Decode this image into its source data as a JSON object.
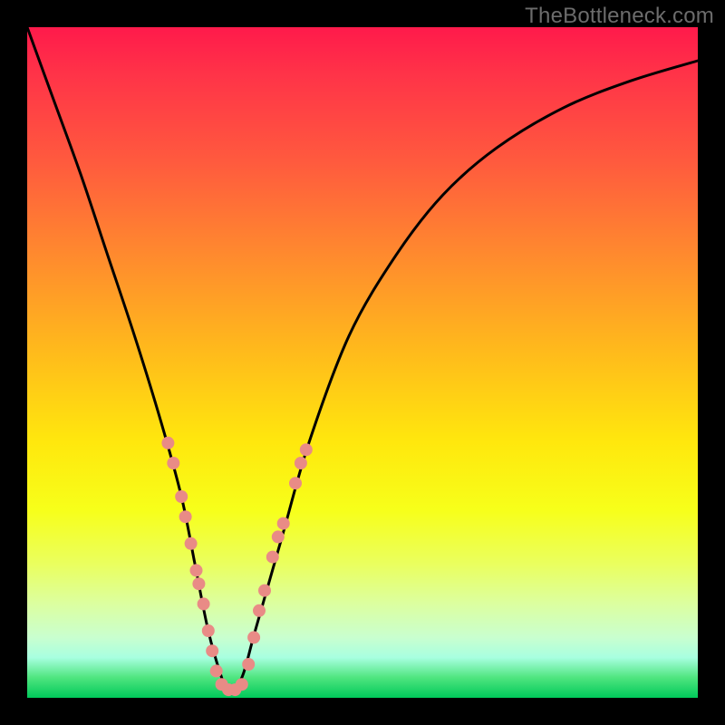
{
  "watermark": "TheBottleneck.com",
  "chart_data": {
    "type": "line",
    "title": "",
    "xlabel": "",
    "ylabel": "",
    "xlim": [
      0,
      100
    ],
    "ylim": [
      0,
      100
    ],
    "grid": false,
    "legend": false,
    "series": [
      {
        "name": "bottleneck-curve",
        "color": "#000000",
        "x": [
          0,
          4,
          8,
          12,
          16,
          20,
          23,
          25,
          27,
          29,
          30,
          32,
          34,
          38,
          42,
          48,
          55,
          62,
          70,
          80,
          90,
          100
        ],
        "y": [
          100,
          89,
          78,
          66,
          54,
          41,
          30,
          20,
          10,
          3,
          1,
          3,
          10,
          24,
          38,
          54,
          66,
          75,
          82,
          88,
          92,
          95
        ]
      }
    ],
    "markers": {
      "color": "#e98b86",
      "radius_px": 7,
      "points": [
        {
          "x": 21.0,
          "y": 38
        },
        {
          "x": 21.8,
          "y": 35
        },
        {
          "x": 23.0,
          "y": 30
        },
        {
          "x": 23.6,
          "y": 27
        },
        {
          "x": 24.4,
          "y": 23
        },
        {
          "x": 25.2,
          "y": 19
        },
        {
          "x": 25.6,
          "y": 17
        },
        {
          "x": 26.3,
          "y": 14
        },
        {
          "x": 27.0,
          "y": 10
        },
        {
          "x": 27.6,
          "y": 7
        },
        {
          "x": 28.2,
          "y": 4
        },
        {
          "x": 29.0,
          "y": 2
        },
        {
          "x": 30.0,
          "y": 1.2
        },
        {
          "x": 31.0,
          "y": 1.2
        },
        {
          "x": 32.0,
          "y": 2
        },
        {
          "x": 33.0,
          "y": 5
        },
        {
          "x": 33.8,
          "y": 9
        },
        {
          "x": 34.6,
          "y": 13
        },
        {
          "x": 35.4,
          "y": 16
        },
        {
          "x": 36.6,
          "y": 21
        },
        {
          "x": 37.4,
          "y": 24
        },
        {
          "x": 38.2,
          "y": 26
        },
        {
          "x": 40.0,
          "y": 32
        },
        {
          "x": 40.8,
          "y": 35
        },
        {
          "x": 41.6,
          "y": 37
        }
      ]
    }
  }
}
